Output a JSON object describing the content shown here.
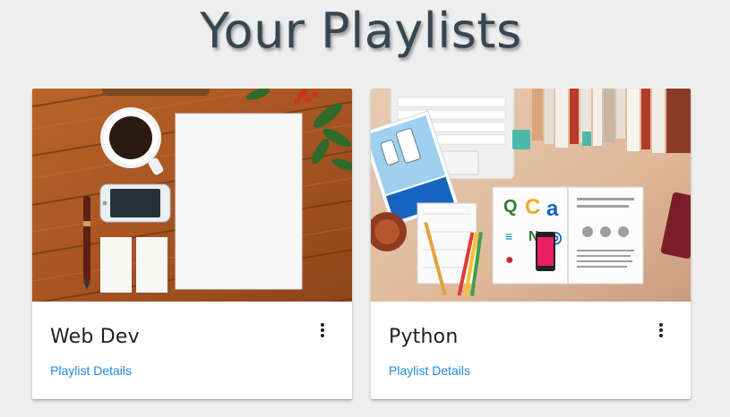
{
  "header": {
    "title": "Your Playlists"
  },
  "playlists": [
    {
      "title": "Web Dev",
      "link_label": "Playlist Details",
      "image": "desk with coffee cup, smartphone, pen and blank paper on wooden table",
      "menu_icon": "more-vert-icon"
    },
    {
      "title": "Python",
      "link_label": "Playlist Details",
      "image": "desk with laptop keyboard, books, iPod brochure, open magazine and pencils",
      "menu_icon": "more-vert-icon"
    }
  ],
  "colors": {
    "background": "#eeeeee",
    "title": "#37474f",
    "link": "#1e88e5",
    "card": "#ffffff"
  }
}
